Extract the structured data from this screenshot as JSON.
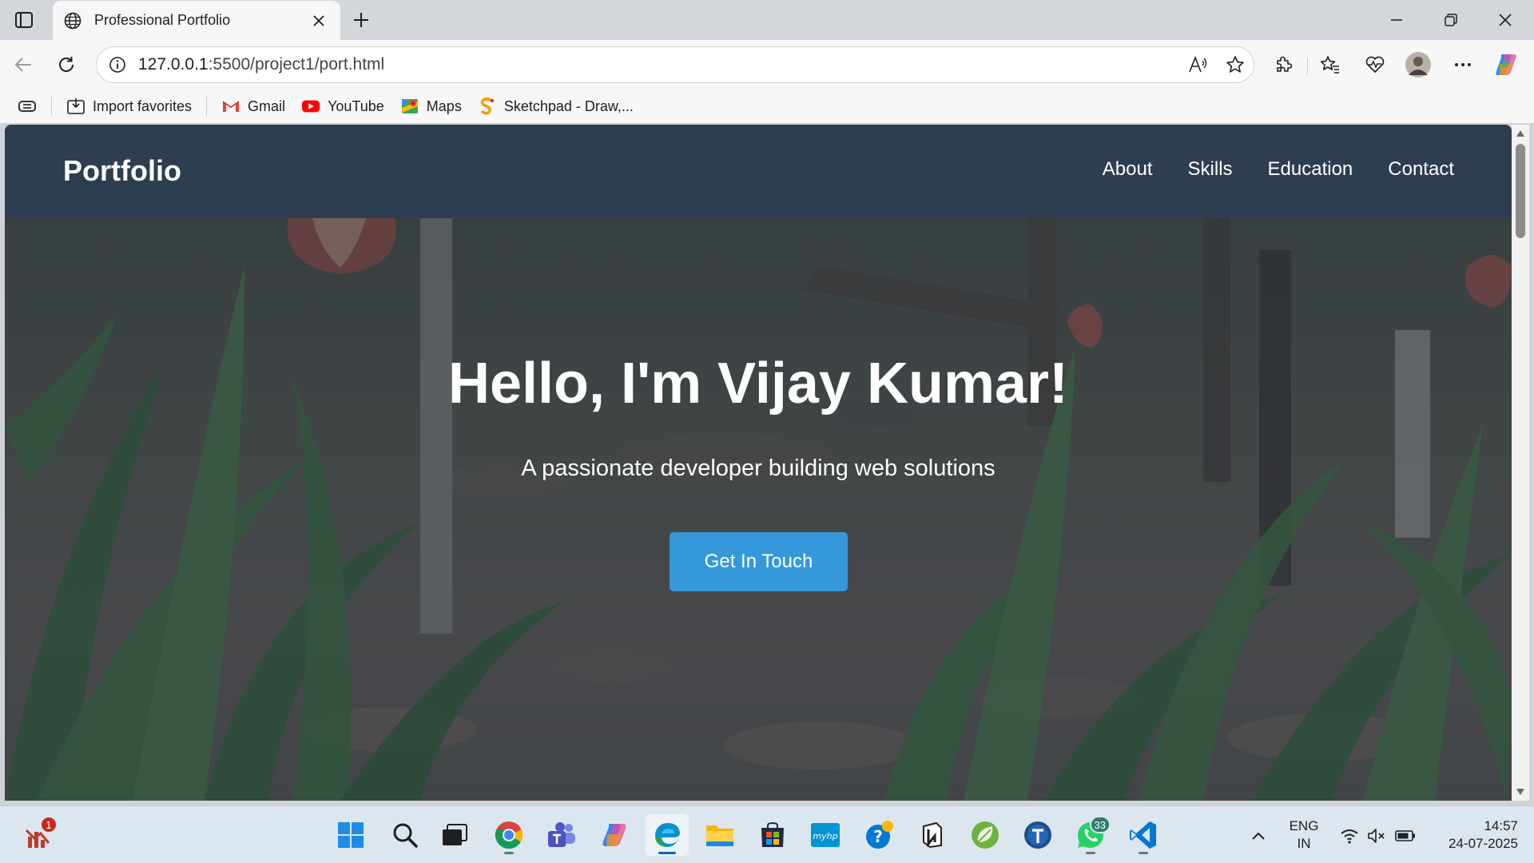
{
  "browser": {
    "tab": {
      "title": "Professional Portfolio"
    },
    "address": {
      "url_host": "127.0.0.1",
      "url_rest": ":5500/project1/port.html"
    },
    "bookmarks": [
      {
        "label": "Import favorites",
        "icon": "import-icon"
      },
      {
        "label": "Gmail",
        "icon": "gmail-icon"
      },
      {
        "label": "YouTube",
        "icon": "youtube-icon"
      },
      {
        "label": "Maps",
        "icon": "maps-icon"
      },
      {
        "label": "Sketchpad - Draw,...",
        "icon": "sketchpad-icon"
      }
    ]
  },
  "page": {
    "nav": {
      "brand": "Portfolio",
      "links": [
        "About",
        "Skills",
        "Education",
        "Contact"
      ]
    },
    "hero": {
      "heading": "Hello, I'm Vijay Kumar!",
      "subheading": "A passionate developer building web solutions",
      "cta": "Get In Touch"
    }
  },
  "taskbar": {
    "widgets_badge": "1",
    "whatsapp_badge": "33",
    "language": "ENG",
    "region": "IN",
    "time": "14:57",
    "date": "24-07-2025"
  },
  "colors": {
    "nav_bg": "#2c3e50",
    "cta_bg": "#3498db",
    "taskbar_bg": "#dbe6ef"
  }
}
